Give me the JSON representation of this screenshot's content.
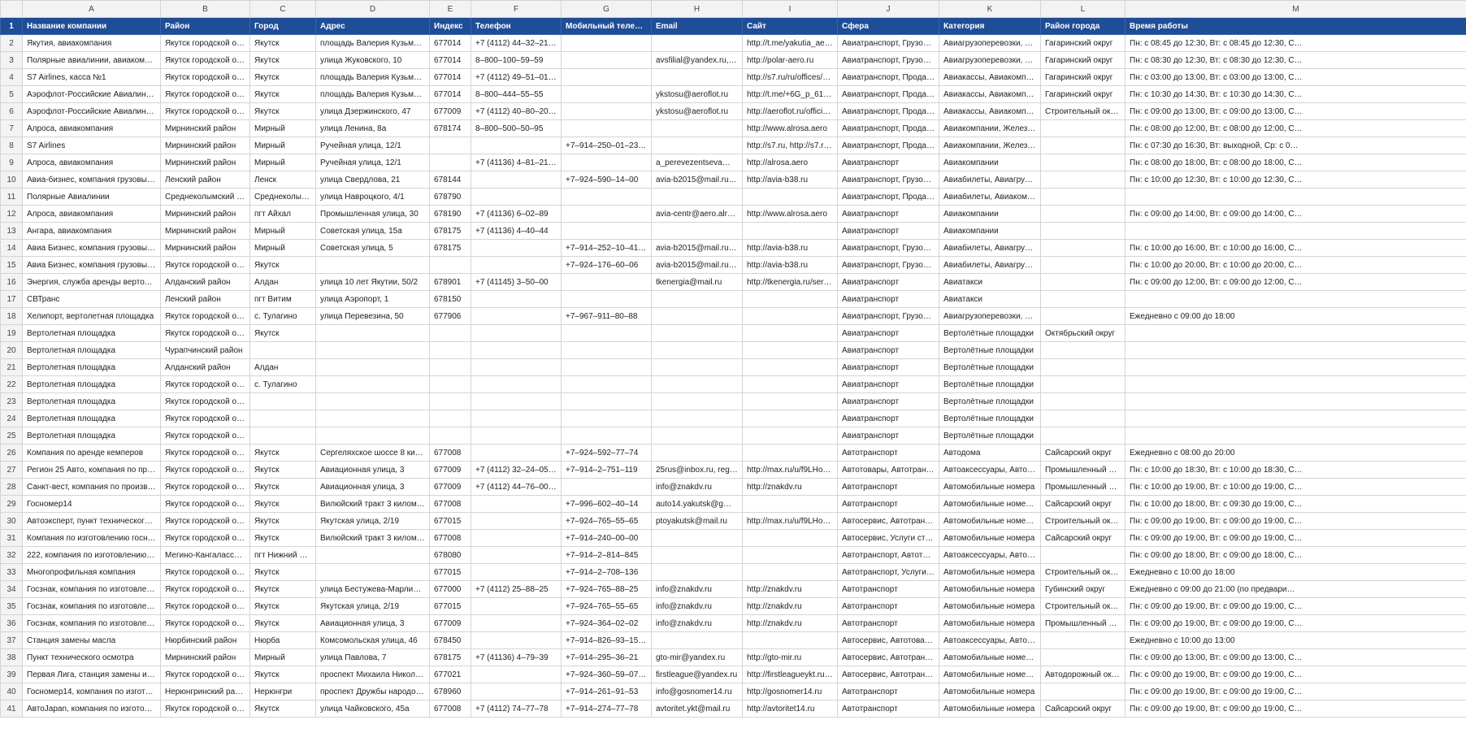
{
  "column_letters": [
    "A",
    "B",
    "C",
    "D",
    "E",
    "F",
    "G",
    "H",
    "I",
    "J",
    "K",
    "L",
    "M"
  ],
  "header": {
    "row_num": "1",
    "cells": [
      "Название компании",
      "Район",
      "Город",
      "Адрес",
      "Индекс",
      "Телефон",
      "Мобильный телефон",
      "Email",
      "Сайт",
      "Сфера",
      "Категория",
      "Район города",
      "Время работы"
    ]
  },
  "rows": [
    {
      "n": "2",
      "c": [
        "Якутия, авиакомпания",
        "Якутск городской округ",
        "Якутск",
        "площадь Валерия Кузьмина, 1",
        "677014",
        "+7 (4112) 44–32–21, 8–…",
        "",
        "",
        "http://t.me/yakutia_aero, …",
        "Авиатранспорт, Грузопере…",
        "Авиагрузоперевозки, Авиа…",
        "Гагаринский округ",
        "Пн: с 08:45 до 12:30, Вт: с 08:45 до 12:30, С…"
      ]
    },
    {
      "n": "3",
      "c": [
        "Полярные авиалинии, авиакомпания",
        "Якутск городской округ",
        "Якутск",
        "улица Жуковского, 10",
        "677014",
        "8–800–100–59–59",
        "",
        "avsfilial@yandex.ru, offi…",
        "http://polar-aero.ru",
        "Авиатранспорт, Грузопере…",
        "Авиагрузоперевозки, Авиа…",
        "Гагаринский округ",
        "Пн: с 08:30 до 12:30, Вт: с 08:30 до 12:30, С…"
      ]
    },
    {
      "n": "4",
      "c": [
        "S7 Airlines, касса №1",
        "Якутск городской округ",
        "Якутск",
        "площадь Валерия Кузьмина, 10",
        "677014",
        "+7 (4112) 49–51–01, 8–…",
        "",
        "",
        "http://s7.ru/ru/offices/YKS…",
        "Авиатранспорт, Продажа …",
        "Авиакассы, Авиакомпании",
        "Гагаринский округ",
        "Пн: с 03:00 до 13:00, Вт: с 03:00 до 13:00, С…"
      ]
    },
    {
      "n": "5",
      "c": [
        "Аэрофлот-Российские Авиалинии, ка…",
        "Якутск городской округ",
        "Якутск",
        "площадь Валерия Кузьмина, 10",
        "677014",
        "8–800–444–55–55",
        "",
        "ykstosu@aeroflot.ru",
        "http://t.me/+6G_p_61Axb…",
        "Авиатранспорт, Продажа …",
        "Авиакассы, Авиакомпании",
        "Гагаринский округ",
        "Пн: с 10:30 до 14:30, Вт: с 10:30 до 14:30, С…"
      ]
    },
    {
      "n": "6",
      "c": [
        "Аэрофлот-Российские Авиалинии, ав…",
        "Якутск городской округ",
        "Якутск",
        "улица Дзержинского, 47",
        "677009",
        "+7 (4112) 40–80–20, 8–…",
        "",
        "ykstosu@aeroflot.ru",
        "http://aeroflot.ru/offici…",
        "Авиатранспорт, Продажа …",
        "Авиакассы, Авиакомпании",
        "Строительный округ",
        "Пн: с 09:00 до 13:00, Вт: с 09:00 до 13:00, С…"
      ]
    },
    {
      "n": "7",
      "c": [
        "Алроса, авиакомпания",
        "Мирнинский район",
        "Мирный",
        "улица Ленина, 8а",
        "678174",
        "8–800–500–50–95",
        "",
        "",
        "http://www.alrosa.aero",
        "Авиатранспорт, Продажа …",
        "Авиакомпании, Железнод…",
        "",
        "Пн: с 08:00 до 12:00, Вт: с 08:00 до 12:00, С…"
      ]
    },
    {
      "n": "8",
      "c": [
        "S7 Airlines",
        "Мирнинский район",
        "Мирный",
        "Ручейная улица, 12/1",
        "",
        "",
        "+7–914–250–01–23, +7…",
        "",
        "http://s7.ru, http://s7.ru/r…",
        "Авиатранспорт, Продажа …",
        "Авиакомпании, Железнод…",
        "",
        "Пн: с 07:30 до 16:30, Вт: выходной, Ср: с 0…"
      ]
    },
    {
      "n": "9",
      "c": [
        "Алроса, авиакомпания",
        "Мирнинский район",
        "Мирный",
        "Ручейная улица, 12/1",
        "",
        "+7 (41136) 4–81–21, +7…",
        "",
        "a_perevezentseva@mlg…",
        "http://alrosa.aero",
        "Авиатранспорт",
        "Авиакомпании",
        "",
        "Пн: с 08:00 до 18:00, Вт: с 08:00 до 18:00, С…"
      ]
    },
    {
      "n": "10",
      "c": [
        "Авиа-бизнес, компания грузовых ави…",
        "Ленский район",
        "Ленск",
        "улица Свердлова, 21",
        "678144",
        "",
        "+7–924–590–14–00",
        "avia-b2015@mail.ru, inf…",
        "http://avia-b38.ru",
        "Авиатранспорт, Грузопере…",
        "Авиабилеты, Авиагрузопе…",
        "",
        "Пн: с 10:00 до 12:30, Вт: с 10:00 до 12:30, С…"
      ]
    },
    {
      "n": "11",
      "c": [
        "Полярные Авиалинии",
        "Среднеколымский рай…",
        "Среднеколымск",
        "улица Навроцкого, 4/1",
        "678790",
        "",
        "",
        "",
        "",
        "Авиатранспорт, Продажа …",
        "Авиабилеты, Авиакомпании",
        "",
        ""
      ]
    },
    {
      "n": "12",
      "c": [
        "Алроса, авиакомпания",
        "Мирнинский район",
        "пгт Айхал",
        "Промышленная улица, 30",
        "678190",
        "+7 (41136) 6–02–89",
        "",
        "avia-centr@aero.alrosa.…",
        "http://www.alrosa.aero",
        "Авиатранспорт",
        "Авиакомпании",
        "",
        "Пн: с 09:00 до 14:00, Вт: с 09:00 до 14:00, С…"
      ]
    },
    {
      "n": "13",
      "c": [
        "Ангара, авиакомпания",
        "Мирнинский район",
        "Мирный",
        "Советская улица, 15а",
        "678175",
        "+7 (41136) 4–40–44",
        "",
        "",
        "",
        "Авиатранспорт",
        "Авиакомпании",
        "",
        ""
      ]
    },
    {
      "n": "14",
      "c": [
        "Авиа Бизнес, компания грузовых ави…",
        "Мирнинский район",
        "Мирный",
        "Советская улица, 5",
        "678175",
        "",
        "+7–914–252–10–41, +7…",
        "avia-b2015@mail.ru, po…",
        "http://avia-b38.ru",
        "Авиатранспорт, Грузопере…",
        "Авиабилеты, Авиагрузопе…",
        "",
        "Пн: с 10:00 до 16:00, Вт: с 10:00 до 16:00, С…"
      ]
    },
    {
      "n": "15",
      "c": [
        "Авиа Бизнес, компания грузовых ави…",
        "Якутск городской округ",
        "Якутск",
        "",
        "",
        "",
        "+7–924–176–60–06",
        "avia-b2015@mail.ru, po…",
        "http://avia-b38.ru",
        "Авиатранспорт, Грузопере…",
        "Авиабилеты, Авиагрузопе…",
        "",
        "Пн: с 10:00 до 20:00, Вт: с 10:00 до 20:00, С…"
      ]
    },
    {
      "n": "16",
      "c": [
        "Энергия, служба аренды вертолета",
        "Алданский район",
        "Алдан",
        "улица 10 лет Якутии, 50/2",
        "678901",
        "+7 (41145) 3–50–00",
        "",
        "tkenergia@mail.ru",
        "http://tkenergia.ru/service…",
        "Авиатранспорт",
        "Авиатакси",
        "",
        "Пн: с 09:00 до 12:00, Вт: с 09:00 до 12:00, С…"
      ]
    },
    {
      "n": "17",
      "c": [
        "СВТранс",
        "Ленский район",
        "пгт Витим",
        "улица Аэропорт, 1",
        "678150",
        "",
        "",
        "",
        "",
        "Авиатранспорт",
        "Авиатакси",
        "",
        ""
      ]
    },
    {
      "n": "18",
      "c": [
        "Хелипорт, вертолетная площадка",
        "Якутск городской округ",
        "с. Тулагино",
        "улица Перевезина, 50",
        "677906",
        "",
        "+7–967–911–80–88",
        "",
        "",
        "Авиатранспорт, Грузопере…",
        "Авиагрузоперевозки, Авиа…",
        "",
        "Ежедневно с 09:00 до 18:00"
      ]
    },
    {
      "n": "19",
      "c": [
        "Вертолетная площадка",
        "Якутск городской округ",
        "Якутск",
        "",
        "",
        "",
        "",
        "",
        "",
        "Авиатранспорт",
        "Вертолётные площадки",
        "Октябрьский округ",
        ""
      ]
    },
    {
      "n": "20",
      "c": [
        "Вертолетная площадка",
        "Чурапчинский район",
        "",
        "",
        "",
        "",
        "",
        "",
        "",
        "Авиатранспорт",
        "Вертолётные площадки",
        "",
        ""
      ]
    },
    {
      "n": "21",
      "c": [
        "Вертолетная площадка",
        "Алданский район",
        "Алдан",
        "",
        "",
        "",
        "",
        "",
        "",
        "Авиатранспорт",
        "Вертолётные площадки",
        "",
        ""
      ]
    },
    {
      "n": "22",
      "c": [
        "Вертолетная площадка",
        "Якутск городской округ",
        "с. Тулагино",
        "",
        "",
        "",
        "",
        "",
        "",
        "Авиатранспорт",
        "Вертолётные площадки",
        "",
        ""
      ]
    },
    {
      "n": "23",
      "c": [
        "Вертолетная площадка",
        "Якутск городской округ",
        "",
        "",
        "",
        "",
        "",
        "",
        "",
        "Авиатранспорт",
        "Вертолётные площадки",
        "",
        ""
      ]
    },
    {
      "n": "24",
      "c": [
        "Вертолетная площадка",
        "Якутск городской округ",
        "",
        "",
        "",
        "",
        "",
        "",
        "",
        "Авиатранспорт",
        "Вертолётные площадки",
        "",
        ""
      ]
    },
    {
      "n": "25",
      "c": [
        "Вертолетная площадка",
        "Якутск городской округ",
        "",
        "",
        "",
        "",
        "",
        "",
        "",
        "Авиатранспорт",
        "Вертолётные площадки",
        "",
        ""
      ]
    },
    {
      "n": "26",
      "c": [
        "Компания по аренде кемперов",
        "Якутск городской округ",
        "Якутск",
        "Сергеляхское шоссе 8 киломе…",
        "677008",
        "",
        "+7–924–592–77–74",
        "",
        "",
        "Автотранспорт",
        "Автодома",
        "Сайсарский округ",
        "Ежедневно с 08:00 до 20:00"
      ]
    },
    {
      "n": "27",
      "c": [
        "Регион 25 Авто, компания по продаж…",
        "Якутск городской округ",
        "Якутск",
        "Авиационная улица, 3",
        "677009",
        "+7 (4112) 32–24–05, +7…",
        "+7–914–2–751–119",
        "25rus@inbox.ru, region…",
        "http://max.ru/u/f9LHodD…",
        "Автотовары, Автотранспо…",
        "Автоаксессуары, Автомоб…",
        "Промышленный округ",
        "Пн: с 10:00 до 18:30, Вт: с 10:00 до 18:30, С…"
      ]
    },
    {
      "n": "28",
      "c": [
        "Санкт-вест, компания по производст…",
        "Якутск городской округ",
        "Якутск",
        "Авиационная улица, 3",
        "677009",
        "+7 (4112) 44–76–00, +7…",
        "",
        "info@znakdv.ru",
        "http://znakdv.ru",
        "Автотранспорт",
        "Автомобильные номера",
        "Промышленный округ",
        "Пн: с 10:00 до 19:00, Вт: с 10:00 до 19:00, С…"
      ]
    },
    {
      "n": "29",
      "c": [
        "Госномер14",
        "Якутск городской округ",
        "Якутск",
        "Вилюйский тракт 3 километр, …",
        "677008",
        "",
        "+7–996–602–40–14",
        "auto14.yakutsk@gmail.…",
        "",
        "Автотранспорт",
        "Автомобильные номера, …",
        "Сайсарский округ",
        "Пн: с 10:00 до 18:00, Вт: с 09:30 до 19:00, С…"
      ]
    },
    {
      "n": "30",
      "c": [
        "Автоэксперт, пункт технического осм…",
        "Якутск городской округ",
        "Якутск",
        "Якутская улица, 2/19",
        "677015",
        "",
        "+7–924–765–55–65",
        "ptoyakutsk@mail.ru",
        "http://max.ru/u/f9LHodD…",
        "Автосервис, Автотранспорт",
        "Автомобильные номера, Г…",
        "Строительный округ",
        "Пн: с 09:00 до 19:00, Вт: с 09:00 до 19:00, С…"
      ]
    },
    {
      "n": "31",
      "c": [
        "Компания по изготовлению госноме…",
        "Якутск городской округ",
        "Якутск",
        "Вилюйский тракт 3 километр, …",
        "677008",
        "",
        "+7–914–240–00–00",
        "",
        "",
        "Автосервис, Услуги стр…",
        "Автомобильные номера",
        "Сайсарский округ",
        "Пн: с 09:00 до 19:00, Вт: с 09:00 до 19:00, С…"
      ]
    },
    {
      "n": "32",
      "c": [
        "222, компания по изготовлению госу…",
        "Мегино-Кангаласский …",
        "пгт Нижний Бес…",
        "",
        "678080",
        "",
        "+7–914–2–814–845",
        "",
        "",
        "Автотранспорт, Автотовары",
        "Автоаксессуары, Автомоб…",
        "",
        "Пн: с 09:00 до 18:00, Вт: с 09:00 до 18:00, С…"
      ]
    },
    {
      "n": "33",
      "c": [
        "Многопрофильная компания",
        "Якутск городской округ",
        "Якутск",
        "",
        "677015",
        "",
        "+7–914–2–708–136",
        "",
        "",
        "Автотранспорт, Услуги стр…",
        "Автомобильные номера",
        "Строительный округ",
        "Ежедневно с 10:00 до 18:00"
      ]
    },
    {
      "n": "34",
      "c": [
        "Госзнак, компания по изготовлению …",
        "Якутск городской округ",
        "Якутск",
        "улица Бестужева-Марлинског…",
        "677000",
        "+7 (4112) 25–88–25",
        "+7–924–765–88–25",
        "info@znakdv.ru",
        "http://znakdv.ru",
        "Автотранспорт",
        "Автомобильные номера",
        "Губинский округ",
        "Ежедневно с 09:00 до 21:00 (по предвари…"
      ]
    },
    {
      "n": "35",
      "c": [
        "Госзнак, компания по изготовлению …",
        "Якутск городской округ",
        "Якутск",
        "Якутская улица, 2/19",
        "677015",
        "",
        "+7–924–765–55–65",
        "info@znakdv.ru",
        "http://znakdv.ru",
        "Автотранспорт",
        "Автомобильные номера",
        "Строительный округ",
        "Пн: с 09:00 до 19:00, Вт: с 09:00 до 19:00, С…"
      ]
    },
    {
      "n": "36",
      "c": [
        "Госзнак, компания по изготовлению …",
        "Якутск городской округ",
        "Якутск",
        "Авиационная улица, 3",
        "677009",
        "",
        "+7–924–364–02–02",
        "info@znakdv.ru",
        "http://znakdv.ru",
        "Автотранспорт",
        "Автомобильные номера",
        "Промышленный округ",
        "Пн: с 09:00 до 19:00, Вт: с 09:00 до 19:00, С…"
      ]
    },
    {
      "n": "37",
      "c": [
        "Станция замены масла",
        "Нюрбинский район",
        "Нюрба",
        "Комсомольская улица, 46",
        "678450",
        "",
        "+7–914–826–93–15, +7…",
        "",
        "",
        "Автосервис, Автотовары, …",
        "Автоаксессуары, Автомоб…",
        "",
        "Ежедневно с 10:00 до 13:00"
      ]
    },
    {
      "n": "38",
      "c": [
        "Пункт технического осмотра",
        "Мирнинский район",
        "Мирный",
        "улица Павлова, 7",
        "678175",
        "+7 (41136) 4–79–39",
        "+7–914–295–36–21",
        "gto-mir@yandex.ru",
        "http://gto-mir.ru",
        "Автосервис, Автотранспор…",
        "Автомобильные номера, …",
        "",
        "Пн: с 09:00 до 13:00, Вт: с 09:00 до 13:00, С…"
      ]
    },
    {
      "n": "39",
      "c": [
        "Первая Лига, станция замены и прод…",
        "Якутск городской округ",
        "Якутск",
        "проспект Михаила Николаева,…",
        "677021",
        "",
        "+7–924–360–59–07, +7…",
        "firstleague@yandex.ru",
        "http://firstleagueykt.ru, ht…",
        "Автосервис, Автотранспор…",
        "Автомобильные номера, А…",
        "Автодорожный округ",
        "Пн: с 09:00 до 19:00, Вт: с 09:00 до 19:00, С…"
      ]
    },
    {
      "n": "40",
      "c": [
        "Госномер14, компания по изготовлен…",
        "Нерюнгринский район",
        "Нерюнгри",
        "проспект Дружбы народов, 27",
        "678960",
        "",
        "+7–914–261–91–53",
        "info@gosnomer14.ru",
        "http://gosnomer14.ru",
        "Автотранспорт",
        "Автомобильные номера",
        "",
        "Пн: с 09:00 до 19:00, Вт: с 09:00 до 19:00, С…"
      ]
    },
    {
      "n": "41",
      "c": [
        "АвтоJapan, компания по изготовлени…",
        "Якутск городской округ",
        "Якутск",
        "улица Чайковского, 45а",
        "677008",
        "+7 (4112) 74–77–78",
        "+7–914–274–77–78",
        "avtoritet.ykt@mail.ru",
        "http://avtoritet14.ru",
        "Автотранспорт",
        "Автомобильные номера",
        "Сайсарский округ",
        "Пн: с 09:00 до 19:00, Вт: с 09:00 до 19:00, С…"
      ]
    }
  ]
}
